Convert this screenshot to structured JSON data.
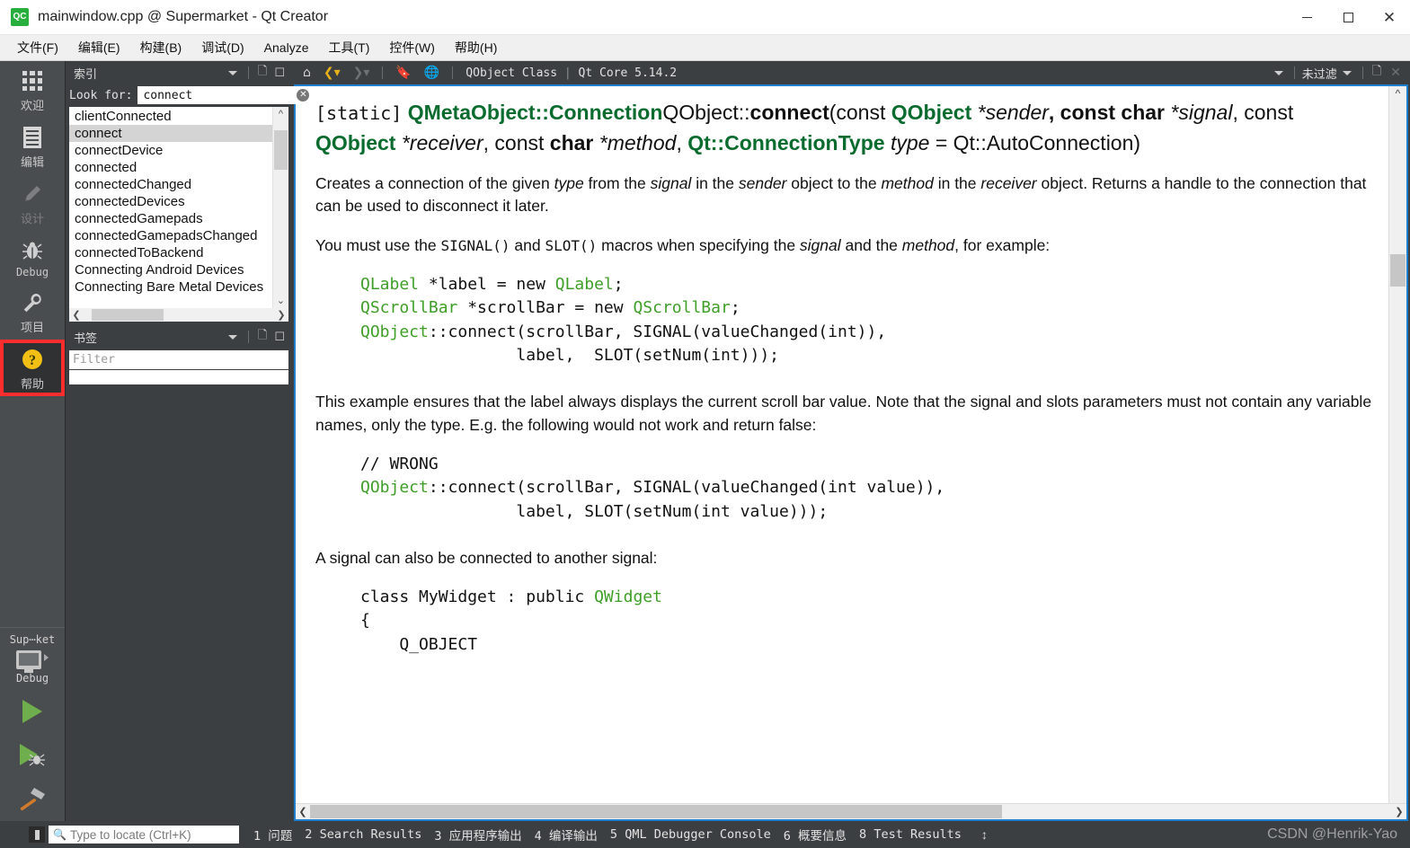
{
  "window": {
    "title": "mainwindow.cpp @ Supermarket - Qt Creator",
    "app_icon_text": "QC",
    "minimize_label": "–",
    "maximize_label": "□",
    "close_label": "✕"
  },
  "menubar": [
    {
      "label": "文件(F)",
      "mnemonic": "F"
    },
    {
      "label": "编辑(E)",
      "mnemonic": "E"
    },
    {
      "label": "构建(B)",
      "mnemonic": "B"
    },
    {
      "label": "调试(D)",
      "mnemonic": "D"
    },
    {
      "label": "Analyze",
      "mnemonic": "A"
    },
    {
      "label": "工具(T)",
      "mnemonic": "T"
    },
    {
      "label": "控件(W)",
      "mnemonic": "W"
    },
    {
      "label": "帮助(H)",
      "mnemonic": "H"
    }
  ],
  "modebar": {
    "items": [
      {
        "label": "欢迎",
        "icon": "grid-icon",
        "state": "normal"
      },
      {
        "label": "编辑",
        "icon": "document-icon",
        "state": "normal"
      },
      {
        "label": "设计",
        "icon": "pencil-icon",
        "state": "disabled"
      },
      {
        "label": "Debug",
        "icon": "bug-icon",
        "state": "normal"
      },
      {
        "label": "项目",
        "icon": "wrench-icon",
        "state": "normal"
      },
      {
        "label": "帮助",
        "icon": "help-question-icon",
        "state": "highlighted"
      }
    ],
    "kit": {
      "project_name": "Sup⋯ket",
      "build_config": "Debug",
      "target_icon": "desktop-monitor-icon"
    },
    "actions": [
      {
        "name": "run-button",
        "icon": "green-play-icon"
      },
      {
        "name": "debug-button",
        "icon": "play-with-bug-icon"
      },
      {
        "name": "build-button",
        "icon": "hammer-icon"
      }
    ]
  },
  "sidepanel": {
    "index": {
      "title": "索引",
      "add_bookmark_icon": "add-page-icon",
      "menu_icon": "panel-menu-icon",
      "look_for_label": "Look for:",
      "search_value": "connect",
      "clear_icon": "clear-circle-icon",
      "items": [
        {
          "label": "clientConnected",
          "selected": false
        },
        {
          "label": "connect",
          "selected": true
        },
        {
          "label": "connectDevice",
          "selected": false
        },
        {
          "label": "connected",
          "selected": false
        },
        {
          "label": "connectedChanged",
          "selected": false
        },
        {
          "label": "connectedDevices",
          "selected": false
        },
        {
          "label": "connectedGamepads",
          "selected": false
        },
        {
          "label": "connectedGamepadsChanged",
          "selected": false
        },
        {
          "label": "connectedToBackend",
          "selected": false
        },
        {
          "label": "Connecting Android Devices",
          "selected": false
        },
        {
          "label": "Connecting Bare Metal Devices",
          "selected": false
        }
      ]
    },
    "bookmarks": {
      "title": "书签",
      "filter_placeholder": "Filter"
    }
  },
  "doctoolbar": {
    "home_icon": "home-icon",
    "back_icon": "back-arrow-icon",
    "forward_icon": "forward-arrow-icon",
    "bookmark_icon": "bookmark-icon",
    "globe_icon": "globe-icon",
    "breadcrumb_page": "QObject Class",
    "breadcrumb_sep": "|",
    "breadcrumb_module": "Qt Core 5.14.2",
    "filter_label": "未过滤",
    "add_tab_icon": "add-page-icon",
    "close_icon": "close-icon"
  },
  "doc": {
    "signature": {
      "static": "[static]",
      "return_type": "QMetaObject::Connection",
      "qualified_name": "QObject::",
      "func_name": "connect",
      "p1_const": "(const ",
      "p1_type": "QObject",
      "p1_name": "*sender",
      "p2_const": ", const ",
      "p2_type": "char",
      "p2_name": "*signal",
      "p3_const": ", const ",
      "p3_type": "QObject",
      "p3_name": "*receiver",
      "p4_const": ", const ",
      "p4_type": "char",
      "p4_name": "*method",
      "p5_const": ", ",
      "p5_type": "Qt::ConnectionType",
      "p5_name": "type",
      "p5_default": " = Qt::AutoConnection)"
    },
    "para1_a": "Creates a connection of the given ",
    "para1_type": "type",
    "para1_b": " from the ",
    "para1_signal": "signal",
    "para1_c": " in the ",
    "para1_sender": "sender",
    "para1_d": " object to the ",
    "para1_method": "method",
    "para1_e": " in the ",
    "para1_receiver": "receiver",
    "para1_f": " object. Returns a handle to the connection that can be used to disconnect it later.",
    "para2_a": "You must use the ",
    "para2_signal_macro": "SIGNAL()",
    "para2_b": " and ",
    "para2_slot_macro": "SLOT()",
    "para2_c": " macros when specifying the ",
    "para2_signal": "signal",
    "para2_d": " and the ",
    "para2_method": "method",
    "para2_e": ", for example:",
    "code1_l1_t1": "QLabel",
    "code1_l1_t2": " *label = new ",
    "code1_l1_t3": "QLabel",
    "code1_l1_t4": ";",
    "code1_l2_t1": "QScrollBar",
    "code1_l2_t2": " *scrollBar = new ",
    "code1_l2_t3": "QScrollBar",
    "code1_l2_t4": ";",
    "code1_l3_t1": "QObject",
    "code1_l3_t2": "::connect(scrollBar, SIGNAL(valueChanged(int)),",
    "code1_l4": "                label,  SLOT(setNum(int)));",
    "para3": "This example ensures that the label always displays the current scroll bar value. Note that the signal and slots parameters must not contain any variable names, only the type. E.g. the following would not work and return false:",
    "code2_l1": "// WRONG",
    "code2_l2_t1": "QObject",
    "code2_l2_t2": "::connect(scrollBar, SIGNAL(valueChanged(int value)),",
    "code2_l3": "                label, SLOT(setNum(int value)));",
    "para4": "A signal can also be connected to another signal:",
    "code3_l1_t1": "class MyWidget : public ",
    "code3_l1_t2": "QWidget",
    "code3_l2": "{",
    "code3_l3": "    Q_OBJECT"
  },
  "statusbar": {
    "locator_placeholder": "Type to locate (Ctrl+K)",
    "search_icon": "magnifier-icon",
    "outputs": [
      {
        "num": "1",
        "label": "问题",
        "cjk": true
      },
      {
        "num": "2",
        "label": "Search Results",
        "cjk": false
      },
      {
        "num": "3",
        "label": "应用程序输出",
        "cjk": true
      },
      {
        "num": "4",
        "label": "编译输出",
        "cjk": true
      },
      {
        "num": "5",
        "label": "QML Debugger Console",
        "cjk": false
      },
      {
        "num": "6",
        "label": "概要信息",
        "cjk": true
      },
      {
        "num": "8",
        "label": "Test Results",
        "cjk": false
      }
    ],
    "updown_icon": "up-down-arrows-icon",
    "watermark": "CSDN @Henrik-Yao"
  },
  "colors": {
    "accent_blue": "#1f7fcf",
    "qt_green": "#0a6b2e",
    "code_green": "#3f9e28",
    "highlight_red": "#ff2d2d",
    "chrome_dark": "#3c3f41"
  }
}
